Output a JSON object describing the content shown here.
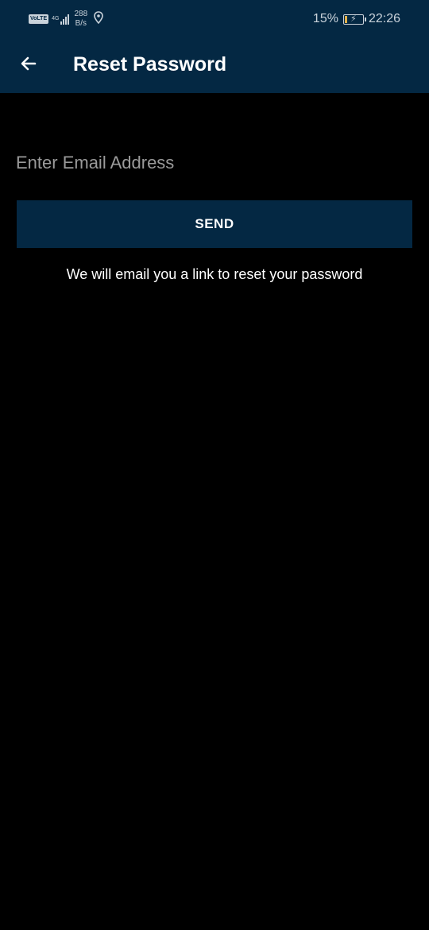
{
  "status_bar": {
    "volte": "VoLTE",
    "network": "4G",
    "speed_value": "288",
    "speed_unit": "B/s",
    "battery_percent": "15%",
    "battery_level": 0.15,
    "time": "22:26",
    "icons": [
      "signal-icon",
      "location-icon",
      "battery-icon"
    ]
  },
  "app_bar": {
    "title": "Reset Password",
    "back_icon": "arrow-back-icon"
  },
  "form": {
    "email_placeholder": "Enter Email Address",
    "email_value": "",
    "send_label": "SEND",
    "hint": "We will email you a link to reset your password"
  },
  "colors": {
    "primary": "#042843",
    "background": "#000000",
    "text": "#ffffff",
    "placeholder": "#9a9a9a"
  }
}
